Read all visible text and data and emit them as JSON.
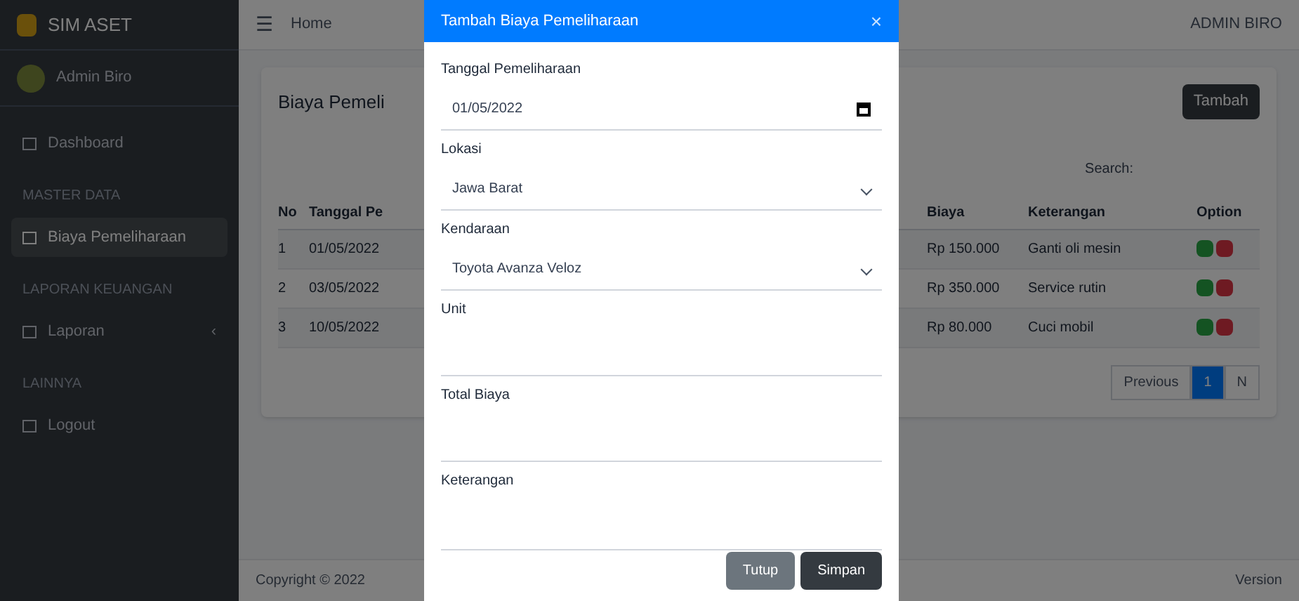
{
  "sidebar": {
    "brand": "SIM ASET",
    "user": "Admin Biro",
    "items": [
      {
        "kind": "link",
        "label": "Dashboard",
        "selected": false
      },
      {
        "kind": "header",
        "label": "MASTER DATA"
      },
      {
        "kind": "link",
        "label": "Biaya Pemeliharaan",
        "selected": true
      },
      {
        "kind": "header",
        "label": "LAPORAN KEUANGAN"
      },
      {
        "kind": "link",
        "label": "Laporan",
        "selected": false,
        "chevron": "‹"
      },
      {
        "kind": "header",
        "label": "LAINNYA"
      },
      {
        "kind": "link",
        "label": "Logout",
        "selected": false
      }
    ]
  },
  "navbar": {
    "menu_icon": "☰",
    "link": "Home",
    "user": "ADMIN BIRO"
  },
  "page": {
    "title": "Biaya Pemeli",
    "add_button": "Tambah",
    "search_label": "Search:",
    "table": {
      "columns": [
        "No",
        "Tanggal Pe",
        "Biaya",
        "Keterangan",
        "Option"
      ],
      "rows": [
        {
          "cells": [
            "1",
            "01/05/2022",
            "Rp 150.000",
            "Ganti oli mesin"
          ]
        },
        {
          "cells": [
            "2",
            "03/05/2022",
            "Rp 350.000",
            "Service rutin"
          ]
        },
        {
          "cells": [
            "3",
            "10/05/2022",
            "Rp 80.000",
            "Cuci mobil"
          ]
        }
      ]
    },
    "pagination": [
      {
        "label": "Previous",
        "selected": false
      },
      {
        "label": "1",
        "selected": true
      },
      {
        "label": "N",
        "selected": false
      }
    ]
  },
  "footer": {
    "left": "Copyright © 2022",
    "right": "Version"
  },
  "modal": {
    "title": "Tambah Biaya Pemeliharaan",
    "close": "×",
    "fields": [
      {
        "kind": "date",
        "label": "Tanggal Pemeliharaan",
        "value": "01/05/2022"
      },
      {
        "kind": "select",
        "label": "Lokasi",
        "value": "Jawa Barat"
      },
      {
        "kind": "select",
        "label": "Kendaraan",
        "value": "Toyota Avanza Veloz"
      },
      {
        "kind": "text",
        "label": "Unit"
      },
      {
        "kind": "text",
        "label": "Total Biaya"
      },
      {
        "kind": "textarea",
        "label": "Keterangan"
      }
    ],
    "buttons": [
      {
        "label": "Tutup",
        "kind": "secondary"
      },
      {
        "label": "Simpan",
        "kind": "primary"
      }
    ]
  }
}
